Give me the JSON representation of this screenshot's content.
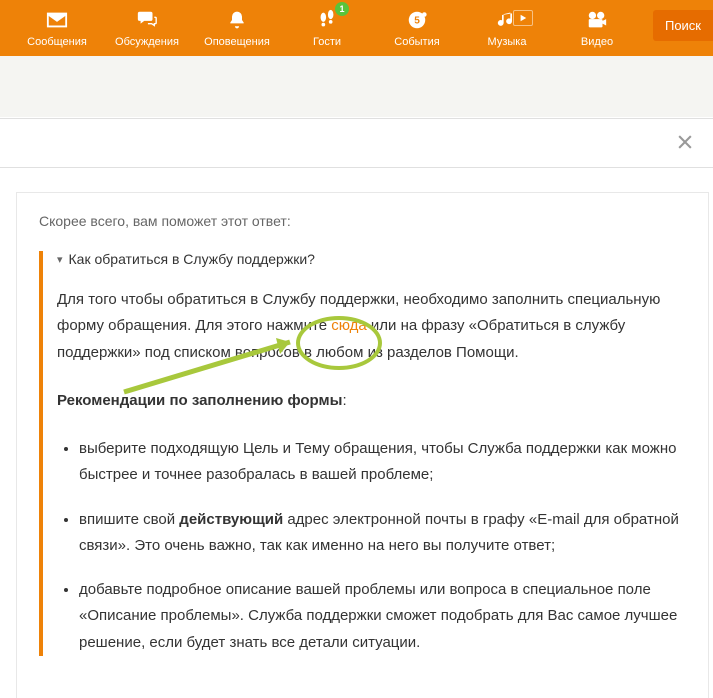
{
  "nav": {
    "items": [
      {
        "label": "Сообщения"
      },
      {
        "label": "Обсуждения"
      },
      {
        "label": "Оповещения"
      },
      {
        "label": "Гости",
        "badge": "1"
      },
      {
        "label": "События"
      },
      {
        "label": "Музыка"
      },
      {
        "label": "Видео"
      }
    ],
    "search": "Поиск"
  },
  "prompt": "Скорее всего, вам поможет этот ответ:",
  "faq": {
    "question": "Как обратиться в Службу поддержки?",
    "p1a": "Для того чтобы обратиться в Службу поддержки, необходимо заполнить специальную форму обращения. Для этого нажмите ",
    "p1_link": "сюда",
    "p1b": " или на фразу «Обратиться в службу поддержки» под списком вопросов в любом из разделов Помощи.",
    "rec_head": "Рекомендации по заполнению формы",
    "bullets": [
      {
        "pre": "выберите подходящую Цель и Тему обращения, чтобы Служба поддержки как можно быстрее и точнее разобралась в вашей проблеме;"
      },
      {
        "pre": "впишите свой ",
        "bold": "действующий",
        "post": " адрес электронной почты в графу «E-mail для обратной связи». Это очень важно, так как именно на него вы получите ответ;"
      },
      {
        "pre": "добавьте подробное описание вашей проблемы или вопроса в специальное поле «Описание проблемы». Служба поддержки сможет подобрать для Вас самое лучшее решение, если будет знать все детали ситуации."
      }
    ]
  }
}
